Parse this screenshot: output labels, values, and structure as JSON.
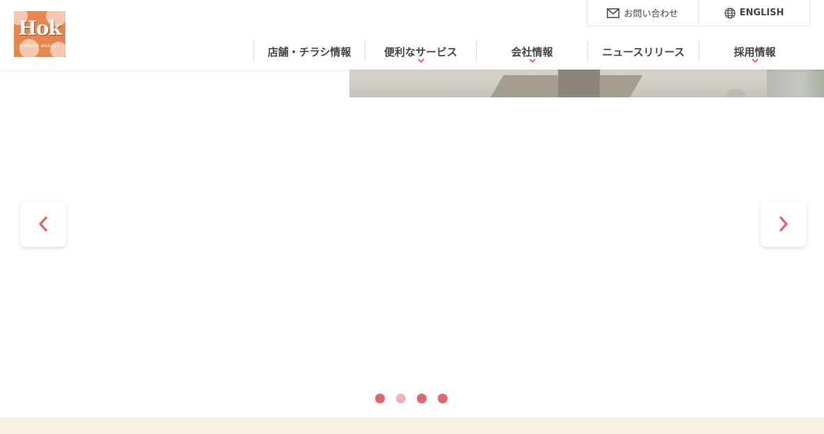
{
  "header": {
    "logo_text": "Hok",
    "logo_sub": "HOKUYU MARKET"
  },
  "utility": {
    "contact_label": "お問い合わせ",
    "language_label": "ENGLISH"
  },
  "nav": {
    "items": [
      {
        "label": "店舗・チラシ情報"
      },
      {
        "label": "便利なサービス"
      },
      {
        "label": "会社情報"
      },
      {
        "label": "ニュースリリース"
      },
      {
        "label": "採用情報"
      }
    ]
  },
  "carousel": {
    "dots": [
      {
        "state": "active"
      },
      {
        "state": "inactive"
      },
      {
        "state": "active"
      },
      {
        "state": "active"
      }
    ]
  },
  "colors": {
    "accent": "#e06670",
    "accent_light": "#f0b3b8",
    "logo_bg": "#e8864f",
    "footer_band": "#f6f0df"
  },
  "icons": {
    "contact": "mail-icon",
    "language": "globe-icon",
    "prev": "chevron-left-icon",
    "next": "chevron-right-icon",
    "dropdown": "chevron-down-icon"
  }
}
